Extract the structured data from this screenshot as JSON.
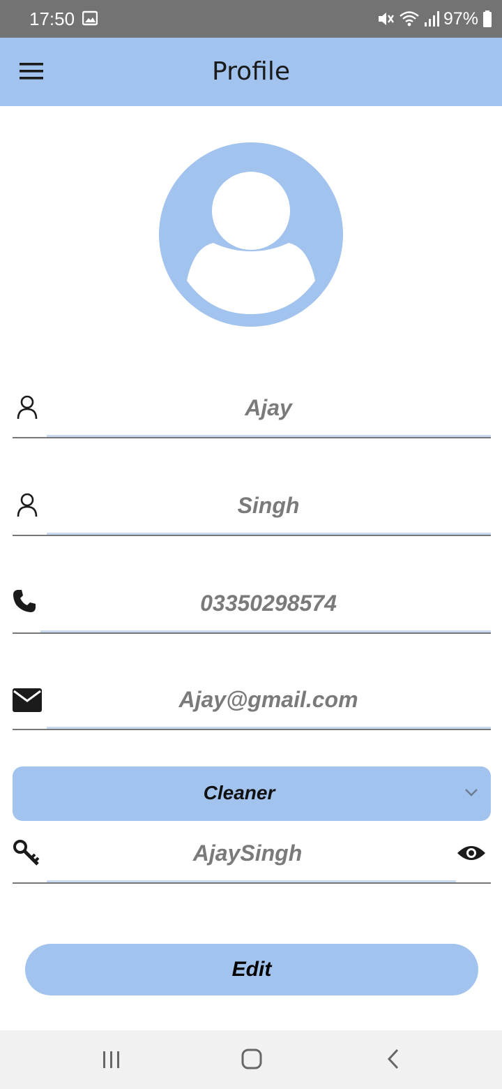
{
  "status_bar": {
    "time": "17:50",
    "battery": "97%",
    "icons": [
      "image-icon",
      "mute-icon",
      "wifi-icon",
      "signal-icon",
      "battery-icon"
    ]
  },
  "header": {
    "title": "Profile",
    "menu_icon": "menu-icon"
  },
  "profile": {
    "avatar_icon": "avatar-placeholder-icon",
    "first_name": "Ajay",
    "last_name": "Singh",
    "phone": "03350298574",
    "email": "Ajay@gmail.com",
    "role": "Cleaner",
    "password": "AjaySingh"
  },
  "actions": {
    "edit_label": "Edit"
  },
  "nav": {
    "buttons": [
      "recent-apps-icon",
      "home-icon",
      "back-icon"
    ]
  },
  "colors": {
    "accent": "#a1c3ee",
    "status_bar": "#737373",
    "field_text": "#7a7a7a",
    "nav_bar": "#f1f1f1"
  }
}
